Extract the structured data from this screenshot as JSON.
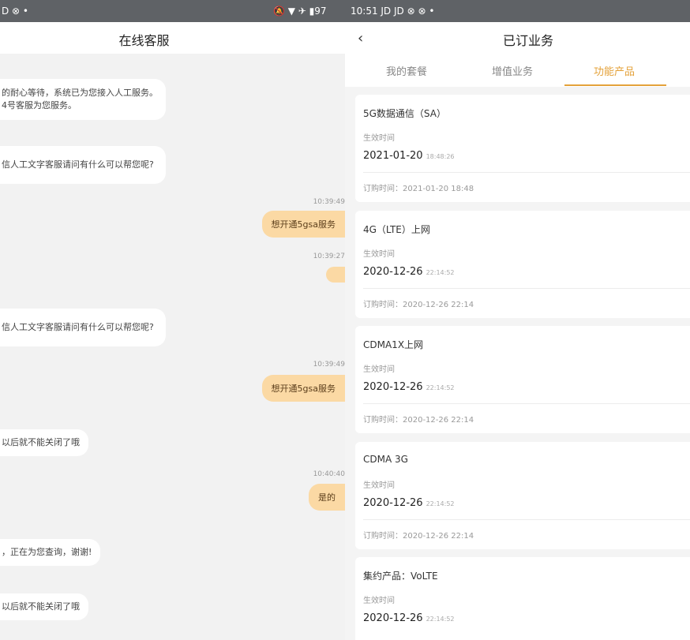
{
  "status": {
    "left": "D ⊗ •",
    "mid": "🔕 ▼ ✈ ▮97",
    "right": "10:51  JD JD ⊗ ⊗ •"
  },
  "left": {
    "title": "在线客服",
    "messages": [
      {
        "line1": "的耐心等待，系统已为您接入人工服务。",
        "line2": "4号客服为您服务。"
      },
      {
        "line1": "信人工文字客服请问有什么可以帮您呢?"
      },
      {
        "ts": "10:39:49"
      },
      {
        "text": "想开通5gsa服务"
      },
      {
        "ts": "10:39:27"
      },
      {
        "text": ""
      },
      {
        "line1": "信人工文字客服请问有什么可以帮您呢?"
      },
      {
        "ts": "10:39:49"
      },
      {
        "text": "想开通5gsa服务"
      },
      {
        "line1": "以后就不能关闭了哦"
      },
      {
        "ts": "10:40:40"
      },
      {
        "text": "是的"
      },
      {
        "line1": "，正在为您查询，谢谢!"
      },
      {
        "line1": "以后就不能关闭了哦"
      }
    ]
  },
  "right": {
    "back": "‹",
    "title": "已订业务",
    "tabs": [
      "我的套餐",
      "增值业务",
      "功能产品"
    ],
    "effective_label": "生效时间",
    "cards": [
      {
        "name": "5G数据通信（SA）",
        "date": "2021-01-20",
        "time": "18:48:26",
        "order": "订购时间：2021-01-20 18:48"
      },
      {
        "name": "4G（LTE）上网",
        "date": "2020-12-26",
        "time": "22:14:52",
        "order": "订购时间：2020-12-26 22:14"
      },
      {
        "name": "CDMA1X上网",
        "date": "2020-12-26",
        "time": "22:14:52",
        "order": "订购时间：2020-12-26 22:14"
      },
      {
        "name": "CDMA 3G",
        "date": "2020-12-26",
        "time": "22:14:52",
        "order": "订购时间：2020-12-26 22:14"
      },
      {
        "name": "集约产品：VoLTE",
        "date": "2020-12-26",
        "time": "22:14:52",
        "order": ""
      }
    ]
  }
}
